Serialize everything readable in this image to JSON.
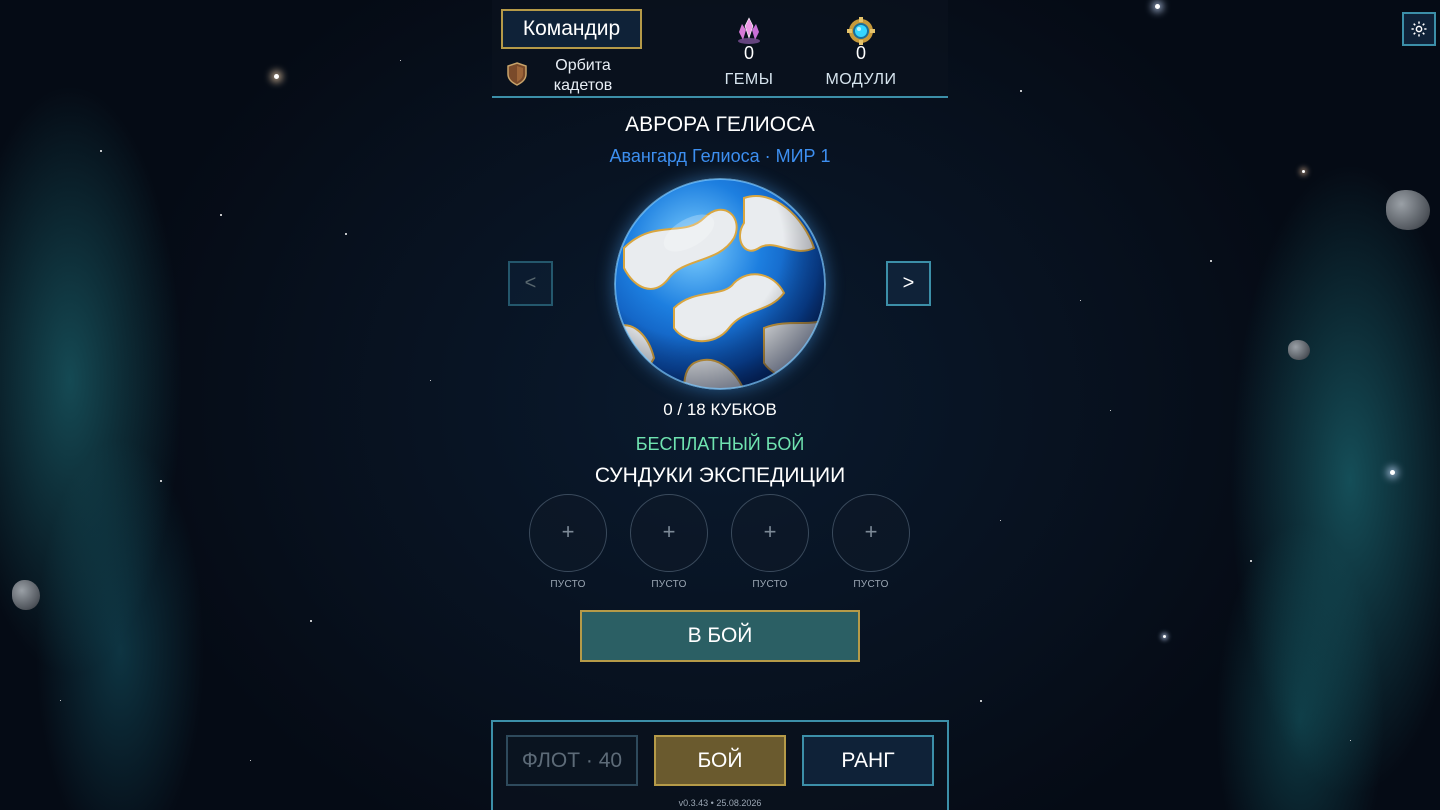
{
  "header": {
    "commander_label": "Командир",
    "rank_name": "Орбита кадетов",
    "gems": {
      "value": "0",
      "label": "ГЕМЫ"
    },
    "modules": {
      "value": "0",
      "label": "МОДУЛИ"
    }
  },
  "world": {
    "title": "АВРОРА ГЕЛИОСА",
    "subtitle": "Авангард Гелиоса · МИР 1",
    "prev_label": "<",
    "next_label": ">",
    "trophies": "0 / 18 КУБКОВ",
    "free_battle": "БЕСПЛАТНЫЙ БОЙ",
    "chests_title": "СУНДУКИ ЭКСПЕДИЦИИ",
    "chests": [
      {
        "symbol": "+",
        "label": "ПУСТО"
      },
      {
        "symbol": "+",
        "label": "ПУСТО"
      },
      {
        "symbol": "+",
        "label": "ПУСТО"
      },
      {
        "symbol": "+",
        "label": "ПУСТО"
      }
    ],
    "battle_button": "В БОЙ"
  },
  "nav": {
    "fleet": "ФЛОТ · 40",
    "battle": "БОЙ",
    "rank": "РАНГ"
  },
  "version": "v0.3.43 • 25.08.2026",
  "colors": {
    "gold_border": "#b59a48",
    "cyan_border": "#3c8fa8",
    "subtitle_blue": "#3d8ff0",
    "free_green": "#6fe3b0",
    "battle_teal": "#2b5f64",
    "active_tab": "#6a5a2e"
  },
  "icons": {
    "rank": "shield-icon",
    "gems": "gem-crystal-icon",
    "modules": "module-gear-icon",
    "settings": "gear-icon"
  }
}
